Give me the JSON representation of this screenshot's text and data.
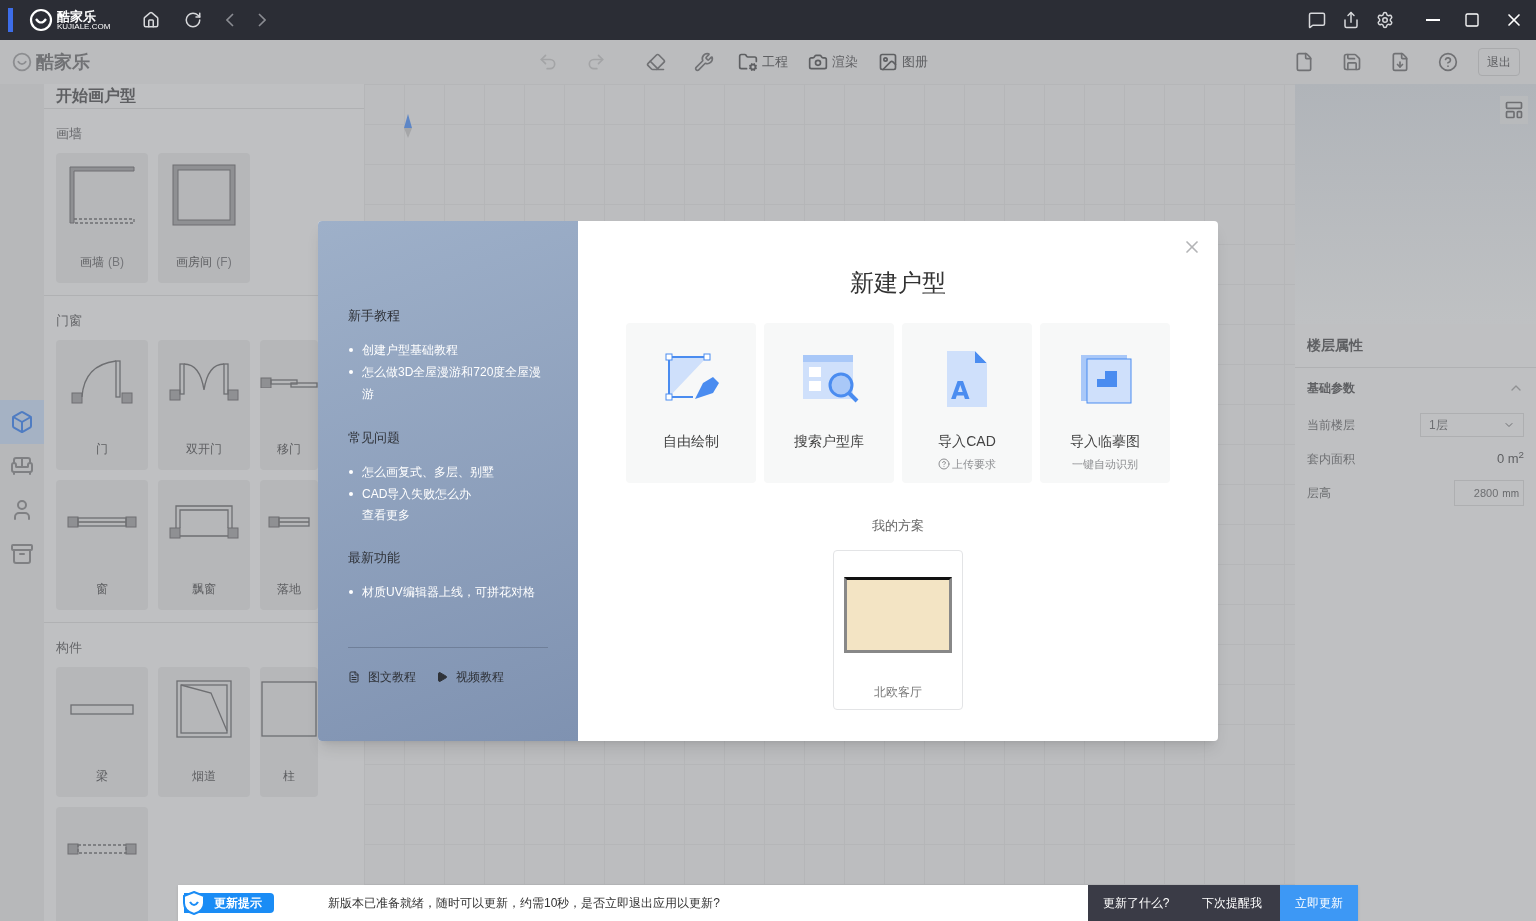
{
  "title_bar": {
    "logo_text": "酷家乐",
    "logo_subtext": "KUJIALE.COM"
  },
  "toolbar": {
    "logo_text": "酷家乐",
    "menus": [
      {
        "label": "工程",
        "kind": "project"
      },
      {
        "label": "渲染",
        "kind": "render"
      },
      {
        "label": "图册",
        "kind": "album"
      }
    ],
    "exit_button": "退出"
  },
  "side_rail": [
    {
      "kind": "cube",
      "selected": true
    },
    {
      "kind": "sofa",
      "selected": false
    },
    {
      "kind": "person",
      "selected": false
    },
    {
      "kind": "cabinet",
      "selected": false
    }
  ],
  "panel": {
    "title": "开始画户型",
    "sections": [
      {
        "title": "画墙",
        "items": [
          {
            "kind": "wall",
            "label": "画墙",
            "shortcut": "(B)"
          },
          {
            "kind": "room",
            "label": "画房间",
            "shortcut": "(F)"
          }
        ]
      },
      {
        "title": "门窗",
        "items": [
          {
            "kind": "door",
            "label": "门"
          },
          {
            "kind": "double-door",
            "label": "双开门"
          },
          {
            "kind": "sliding-door",
            "label": "移门"
          },
          {
            "kind": "window",
            "label": "窗"
          },
          {
            "kind": "bay-window",
            "label": "飘窗"
          },
          {
            "kind": "floor-window",
            "label": "落地"
          }
        ]
      },
      {
        "title": "构件",
        "items": [
          {
            "kind": "beam",
            "label": "梁"
          },
          {
            "kind": "flue",
            "label": "烟道"
          },
          {
            "kind": "column",
            "label": "柱"
          },
          {
            "kind": "opening"
          }
        ]
      }
    ]
  },
  "properties": {
    "title": "楼层属性",
    "section": "基础参数",
    "expanded": true,
    "rows": [
      {
        "kind": "select",
        "label": "当前楼层",
        "value": "1层"
      },
      {
        "kind": "text",
        "label": "套内面积",
        "value": "0 m$^{2}$"
      },
      {
        "kind": "input",
        "label": "层高",
        "value": "2800",
        "unit": "mm"
      }
    ]
  },
  "dialog": {
    "sections": [
      {
        "title": "新手教程",
        "links": [
          "创建户型基础教程",
          "怎么做3D全屋漫游和720度全屋漫游"
        ]
      },
      {
        "title": "常见问题",
        "links": [
          "怎么画复式、多层、别墅",
          "CAD导入失败怎么办"
        ],
        "more": "查看更多"
      },
      {
        "title": "最新功能",
        "links": [
          "材质UV编辑器上线，可拼花对格"
        ]
      }
    ],
    "footer_links": [
      {
        "kind": "doc",
        "label": "图文教程"
      },
      {
        "kind": "video",
        "label": "视频教程"
      }
    ],
    "title": "新建户型",
    "options": [
      {
        "kind": "draw",
        "label": "自由绘制"
      },
      {
        "kind": "search",
        "label": "搜索户型库"
      },
      {
        "kind": "cad",
        "icon_letter": "A",
        "label": "导入CAD",
        "hint": "上传要求",
        "help": true
      },
      {
        "kind": "trace",
        "label": "导入临摹图",
        "hint": "一键自动识别",
        "help": false
      }
    ],
    "plans_title": "我的方案",
    "plans": [
      {
        "name": "北欧客厅"
      }
    ]
  },
  "update_bar": {
    "badge": "更新提示",
    "message": "新版本已准备就绪，随时可以更新，约需10秒，是否立即退出应用以更新?",
    "buttons": [
      {
        "label": "更新了什么?",
        "kind": "dark"
      },
      {
        "label": "下次提醒我",
        "kind": "dark"
      },
      {
        "label": "立即更新",
        "kind": "primary"
      }
    ]
  }
}
